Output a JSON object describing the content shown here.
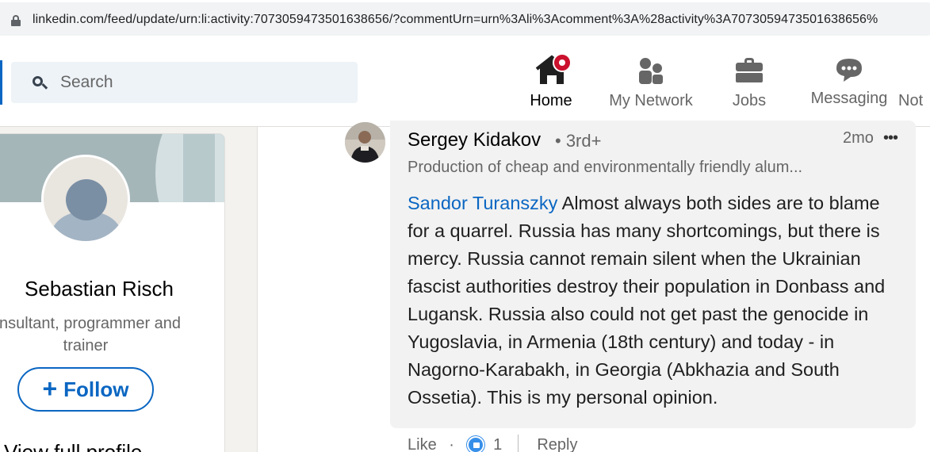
{
  "browser": {
    "url": "linkedin.com/feed/update/urn:li:activity:7073059473501638656/?commentUrn=urn%3Ali%3Acomment%3A%28activity%3A7073059473501638656%"
  },
  "nav": {
    "search_placeholder": "Search",
    "items": [
      {
        "label": "Home",
        "icon": "home-icon",
        "active": true
      },
      {
        "label": "My Network",
        "icon": "network-icon"
      },
      {
        "label": "Jobs",
        "icon": "briefcase-icon"
      },
      {
        "label": "Messaging",
        "icon": "message-icon"
      },
      {
        "label": "Not",
        "icon": "bell-icon"
      }
    ],
    "accent": "#0a66c2",
    "badge_color": "#cb112d"
  },
  "profile_card": {
    "name": "Sebastian Risch",
    "headline": "onsultant, programmer and trainer",
    "follow_label": "Follow",
    "view_profile": "View full profile"
  },
  "comment": {
    "author": "Sergey Kidakov",
    "degree": "• 3rd+",
    "time": "2mo",
    "more": "•••",
    "headline": "Production of cheap and environmentally friendly alum...",
    "mention": "Sandor Turanszky",
    "text": " Almost always both sides are to blame for a quarrel. Russia has many shortcomings, but there is mercy. Russia cannot remain silent when the Ukrainian fascist authorities destroy their population in Donbass and Lugansk. Russia also could not get past the genocide in Yugoslavia, in Armenia (18th century) and today - in Nagorno-Karabakh, in Georgia (Abkhazia and South Ossetia). This is my personal opinion.",
    "like_label": "Like",
    "dot": "·",
    "reaction_count": "1",
    "reply_label": "Reply"
  }
}
